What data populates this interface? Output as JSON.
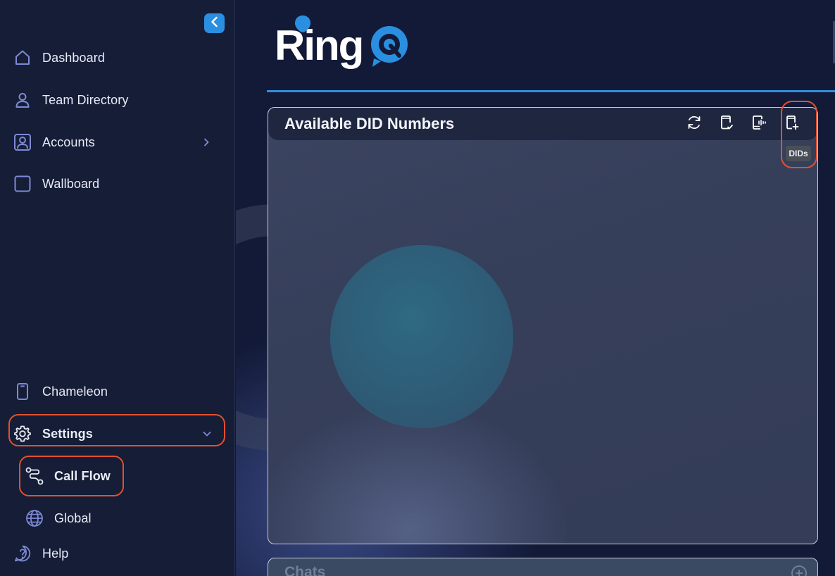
{
  "sidebar": {
    "collapse_label": "",
    "items": [
      {
        "label": "Dashboard",
        "icon": "home-icon"
      },
      {
        "label": "Team Directory",
        "icon": "user-icon"
      },
      {
        "label": "Accounts",
        "icon": "account-box-icon"
      },
      {
        "label": "Wallboard",
        "icon": "square-icon"
      },
      {
        "label": "Chameleon",
        "icon": "phone-icon"
      },
      {
        "label": "Settings",
        "icon": "gear-icon"
      },
      {
        "label": "Call Flow",
        "icon": "route-icon"
      },
      {
        "label": "Global",
        "icon": "globe-icon"
      },
      {
        "label": "Help",
        "icon": "help-icon"
      }
    ]
  },
  "brand": {
    "logo_text": "Ring",
    "accent_color": "#2a8fe0"
  },
  "did_card": {
    "title": "Available DID Numbers",
    "tools": [
      {
        "icon": "refresh-icon"
      },
      {
        "icon": "phone-check-icon"
      },
      {
        "icon": "phone-audio-icon"
      },
      {
        "icon": "phone-add-icon"
      }
    ],
    "tooltip": "DIDs"
  },
  "chats_card": {
    "title": "Chats",
    "add_icon": "plus-circle-icon"
  },
  "colors": {
    "highlight": "#e2502f",
    "sidebar_bg": "#161d36",
    "main_bg": "#131a38"
  }
}
